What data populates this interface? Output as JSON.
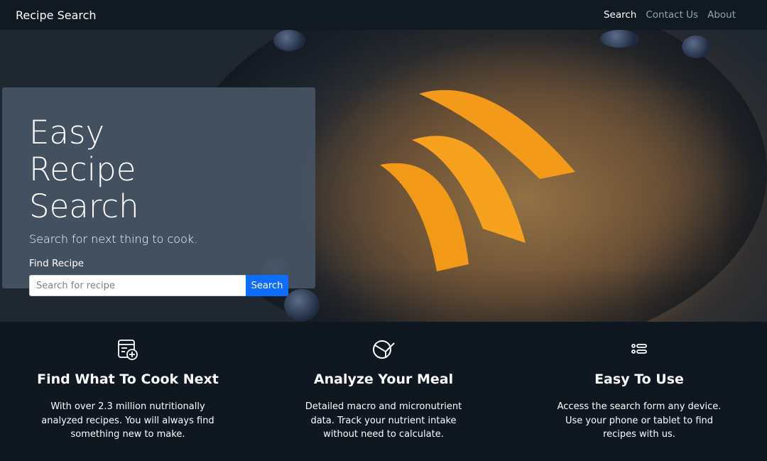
{
  "navbar": {
    "brand": "Recipe Search",
    "links": [
      "Search",
      "Contact Us",
      "About"
    ]
  },
  "hero": {
    "title": "Easy Recipe Search",
    "lead": "Search for next thing to cook.",
    "form_label": "Find Recipe",
    "search_placeholder": "Search for recipe",
    "search_button": "Search"
  },
  "features": [
    {
      "icon": "recipe-book-icon",
      "title": "Find What To Cook Next",
      "text": "With over 2.3 million nutritionally analyzed recipes. You will always find something new to make."
    },
    {
      "icon": "pie-chart-icon",
      "title": "Analyze Your Meal",
      "text": "Detailed macro and micronutrient data. Track your nutrient intake without need to calculate."
    },
    {
      "icon": "list-icon",
      "title": "Easy To Use",
      "text": "Access the search form any device. Use your phone or tablet to find recipes with us."
    }
  ],
  "colors": {
    "navbar_bg": "#111922",
    "accent": "#0d6efd",
    "page_bg": "#0f1720"
  }
}
